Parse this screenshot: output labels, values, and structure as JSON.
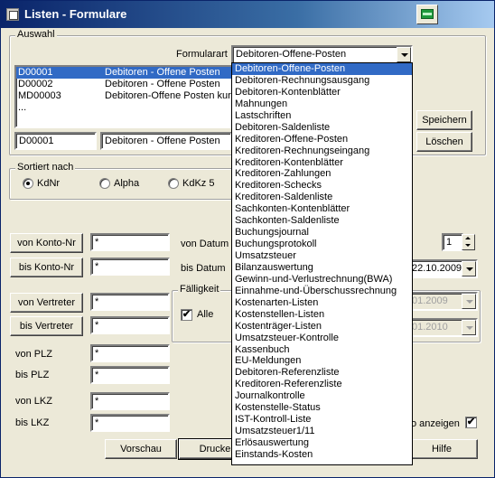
{
  "window": {
    "title": "Listen - Formulare",
    "title_icon": "app-icon",
    "print_icon": "printer-icon"
  },
  "auswahl": {
    "legend": "Auswahl",
    "formularart_label": "Formularart",
    "formularart_value": "Debitoren-Offene-Posten",
    "list": [
      {
        "code": "D00001",
        "name": "Debitoren - Offene Posten",
        "selected": true
      },
      {
        "code": "D00002",
        "name": "Debitoren - Offene Posten",
        "selected": false
      },
      {
        "code": "MD00003",
        "name": "Debitoren-Offene Posten kurz",
        "selected": false
      },
      {
        "code": "...",
        "name": "",
        "selected": false
      }
    ],
    "code_field": "D00001",
    "name_field": "Debitoren - Offene Posten",
    "save_label": "Speichern",
    "delete_label": "Löschen"
  },
  "sort": {
    "legend": "Sortiert nach",
    "options": [
      {
        "label": "KdNr",
        "checked": true
      },
      {
        "label": "Alpha",
        "checked": false
      },
      {
        "label": "KdKz 5",
        "checked": false
      }
    ]
  },
  "filters": {
    "von_konto_btn": "von Konto-Nr",
    "von_konto_val": "*",
    "bis_konto_btn": "bis Konto-Nr",
    "bis_konto_val": "*",
    "von_vertreter_btn": "von Vertreter",
    "von_vertreter_val": "*",
    "bis_vertreter_btn": "bis Vertreter",
    "bis_vertreter_val": "*",
    "von_plz_label": "von PLZ",
    "von_plz_val": "*",
    "bis_plz_label": "bis  PLZ",
    "bis_plz_val": "*",
    "von_lkz_label": "von LKZ",
    "von_lkz_val": "*",
    "bis_lkz_label": "bis  LKZ",
    "bis_lkz_val": "*"
  },
  "dates": {
    "von_datum_label": "von Datum",
    "bis_datum_label": "bis Datum",
    "bis_datum_value": "22.10.2009",
    "spinner_value": "1"
  },
  "faelligkeit": {
    "legend": "Fälligkeit",
    "alle_label": "Alle",
    "alle_checked": true,
    "date1": "01.2009",
    "date2": "01.2010"
  },
  "misc": {
    "anzeigen_label": "o anzeigen",
    "anzeigen_checked": true
  },
  "footer": {
    "preview": "Vorschau",
    "print": "Drucke",
    "help": "Hilfe"
  },
  "dropdown_items": [
    "Debitoren-Offene-Posten",
    "Debitoren-Rechnungsausgang",
    "Debitoren-Kontenblätter",
    "Mahnungen",
    "Lastschriften",
    "Debitoren-Saldenliste",
    "Kreditoren-Offene-Posten",
    "Kreditoren-Rechnungseingang",
    "Kreditoren-Kontenblätter",
    "Kreditoren-Zahlungen",
    "Kreditoren-Schecks",
    "Kreditoren-Saldenliste",
    "Sachkonten-Kontenblätter",
    "Sachkonten-Saldenliste",
    "Buchungsjournal",
    "Buchungsprotokoll",
    "Umsatzsteuer",
    "Bilanzauswertung",
    "Gewinn-und-Verlustrechnung(BWA)",
    "Einnahme-und-Überschussrechnung",
    "Kostenarten-Listen",
    "Kostenstellen-Listen",
    "Kostenträger-Listen",
    "Umsatzsteuer-Kontrolle",
    "Kassenbuch",
    "EU-Meldungen",
    "Debitoren-Referenzliste",
    "Kreditoren-Referenzliste",
    "Journalkontrolle",
    "Kostenstelle-Status",
    "IST-Kontroll-Liste",
    "Umsatzsteuer1/11",
    "Erlösauswertung",
    "Einstands-Kosten"
  ]
}
